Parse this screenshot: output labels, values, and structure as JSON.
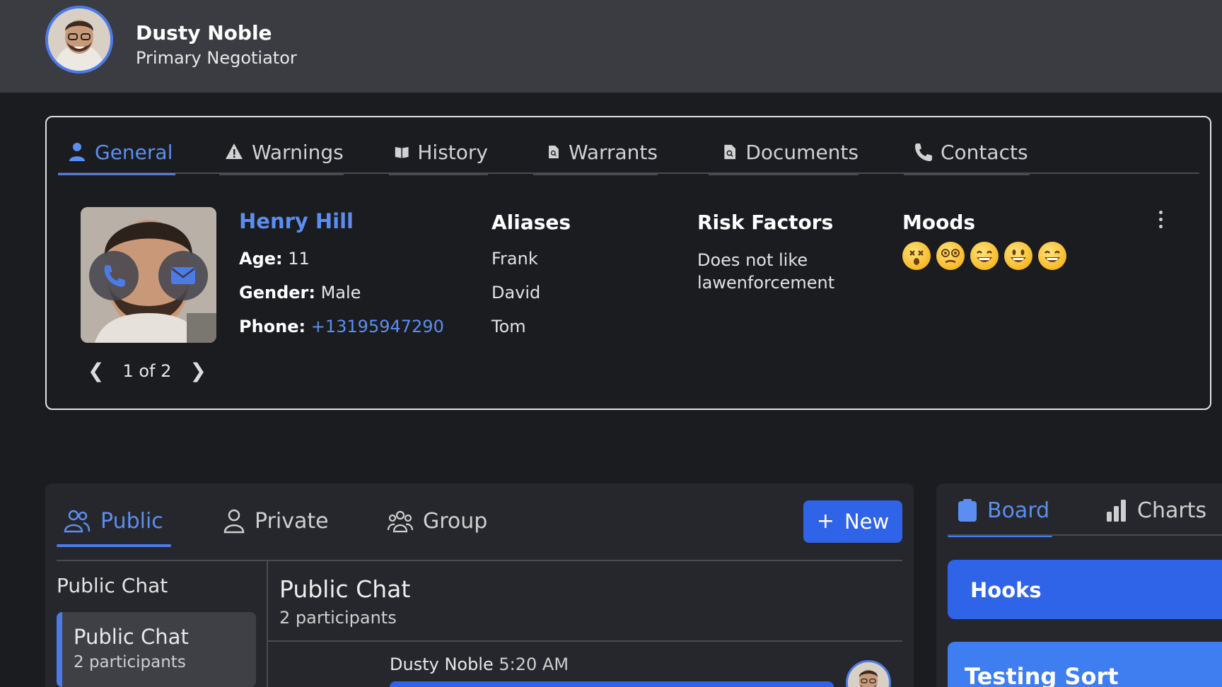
{
  "user": {
    "name": "Dusty Noble",
    "role": "Primary Negotiator"
  },
  "profile_tabs": [
    {
      "label": "General",
      "icon": "person-icon",
      "active": true
    },
    {
      "label": "Warnings",
      "icon": "warning-icon",
      "active": false
    },
    {
      "label": "History",
      "icon": "book-icon",
      "active": false
    },
    {
      "label": "Warrants",
      "icon": "document-search-icon",
      "active": false
    },
    {
      "label": "Documents",
      "icon": "document-search-icon",
      "active": false
    },
    {
      "label": "Contacts",
      "icon": "phone-icon",
      "active": false
    }
  ],
  "subject": {
    "name": "Henry Hill",
    "age_label": "Age:",
    "age": "11",
    "gender_label": "Gender:",
    "gender": "Male",
    "phone_label": "Phone:",
    "phone": "+13195947290",
    "pager": "1 of 2"
  },
  "aliases": {
    "title": "Aliases",
    "items": [
      "Frank",
      "David",
      "Tom"
    ]
  },
  "risk_factors": {
    "title": "Risk Factors",
    "text": "Does not like lawenforcement"
  },
  "moods": {
    "title": "Moods",
    "items": [
      "astonished-face-icon",
      "dizzy-face-icon",
      "grinning-face-icon",
      "smiling-face-icon",
      "grinning-face-icon"
    ]
  },
  "chat": {
    "tabs": [
      {
        "label": "Public",
        "icon": "users-icon",
        "active": true
      },
      {
        "label": "Private",
        "icon": "user-icon",
        "active": false
      },
      {
        "label": "Group",
        "icon": "group-icon",
        "active": false
      }
    ],
    "new_label": "New",
    "list_title": "Public Chat",
    "list_items": [
      {
        "title": "Public Chat",
        "sub": "2 participants"
      }
    ],
    "header_title": "Public Chat",
    "header_sub": "2 participants",
    "message": {
      "author": "Dusty Noble",
      "time": "5:20 AM"
    }
  },
  "board": {
    "tabs": [
      {
        "label": "Board",
        "icon": "clipboard-icon",
        "active": true
      },
      {
        "label": "Charts",
        "icon": "bar-chart-icon",
        "active": false
      }
    ],
    "cards": [
      "Hooks",
      "Testing Sort"
    ]
  },
  "colors": {
    "accent": "#4c7be8",
    "header_bg": "#3b3c42",
    "page_bg": "#1b1c20"
  }
}
